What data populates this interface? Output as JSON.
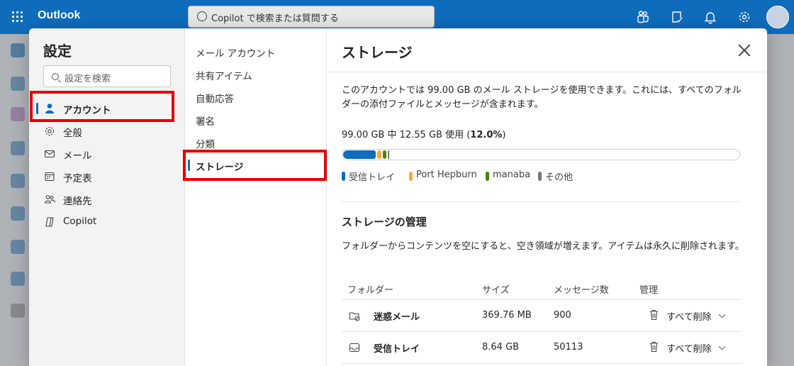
{
  "app": {
    "name": "Outlook"
  },
  "search": {
    "placeholder": "Copilot で検索または質問する"
  },
  "settings": {
    "title": "設定",
    "search_placeholder": "設定を検索",
    "nav": [
      {
        "label": "アカウント",
        "icon": "person-icon",
        "selected": true
      },
      {
        "label": "全般",
        "icon": "gear-icon"
      },
      {
        "label": "メール",
        "icon": "mail-icon"
      },
      {
        "label": "予定表",
        "icon": "calendar-icon"
      },
      {
        "label": "連絡先",
        "icon": "contacts-icon"
      },
      {
        "label": "Copilot",
        "icon": "copilot-icon"
      }
    ]
  },
  "account_nav": [
    {
      "label": "メール アカウント"
    },
    {
      "label": "共有アイテム"
    },
    {
      "label": "自動応答"
    },
    {
      "label": "署名"
    },
    {
      "label": "分類"
    },
    {
      "label": "ストレージ",
      "selected": true
    }
  ],
  "storage": {
    "title": "ストレージ",
    "description": "このアカウントでは 99.00 GB のメール ストレージを使用できます。これには、すべてのフォルダーの添付ファイルとメッセージが含まれます。",
    "usage_prefix": "99.00 GB 中 12.55 GB 使用 (",
    "usage_percent": "12.0%",
    "usage_suffix": ")",
    "usage_fraction": 0.12,
    "legend": [
      {
        "label": "受信トレイ",
        "color": "#0f6cbd",
        "share": 0.085
      },
      {
        "label": "Port Hepburn",
        "color": "#f7a940",
        "share": 0.015
      },
      {
        "label": "manaba",
        "color": "#498205",
        "share": 0.012
      },
      {
        "label": "その他",
        "color": "#7a7574",
        "share": 0.008
      }
    ],
    "manage_title": "ストレージの管理",
    "manage_description": "フォルダーからコンテンツを空にすると、空き領域が増えます。アイテムは永久に削除されます。",
    "columns": {
      "folder": "フォルダー",
      "size": "サイズ",
      "messages": "メッセージ数",
      "manage": "管理"
    },
    "rows": [
      {
        "folder": "迷惑メール",
        "size": "369.76 MB",
        "messages": "900",
        "action": "すべて削除"
      },
      {
        "folder": "受信トレイ",
        "size": "8.64 GB",
        "messages": "50113",
        "action": "すべて削除"
      }
    ]
  }
}
